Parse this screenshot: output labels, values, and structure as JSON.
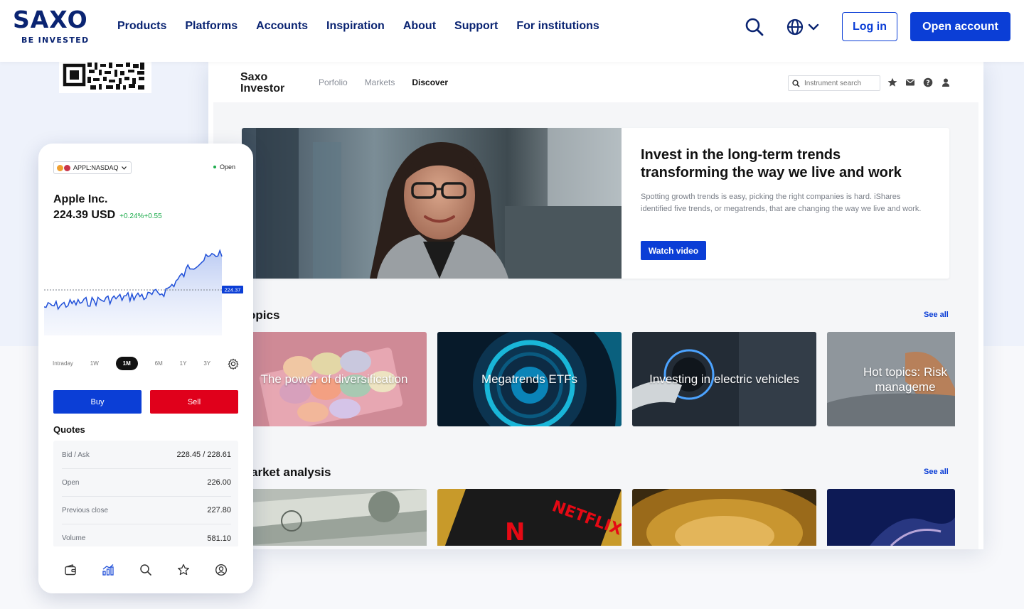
{
  "brand": {
    "name": "SAXO",
    "tagline": "BE INVESTED",
    "accent": "#0b3ed6",
    "navy": "#0a2472"
  },
  "nav": {
    "links": [
      "Products",
      "Platforms",
      "Accounts",
      "Inspiration",
      "About",
      "Support",
      "For institutions"
    ],
    "login_label": "Log in",
    "open_account_label": "Open account"
  },
  "desktop": {
    "app_title": "Saxo Investor",
    "tabs": [
      "Porfolio",
      "Markets",
      "Discover"
    ],
    "active_tab": "Discover",
    "search_placeholder": "Instrument search",
    "hero": {
      "title": "Invest in the long-term trends transforming the way we live and work",
      "body": "Spotting growth trends is easy, picking the right companies is hard. iShares identified five trends, or megatrends, that are changing the way we live and work.",
      "button": "Watch video"
    },
    "topics": {
      "title": "opics",
      "see_all": "See all",
      "tiles": [
        "The power of diversification",
        "Megatrends ETFs",
        "Investing in electric vehicles",
        "Hot topics: Risk manageme"
      ]
    },
    "market_analysis": {
      "title": "arket analysis",
      "see_all": "See all"
    }
  },
  "phone": {
    "ticker": "APPL:NASDAQ",
    "market_status": "Open",
    "company": "Apple Inc.",
    "price": "224.39 USD",
    "change_pct": "+0.24%",
    "change_abs": "+0.55",
    "chart_last_label": "224.37",
    "periods": [
      "Intraday",
      "1W",
      "1M",
      "6M",
      "1Y",
      "3Y"
    ],
    "active_period": "1M",
    "buy_label": "Buy",
    "sell_label": "Sell",
    "quotes_title": "Quotes",
    "quotes": [
      {
        "label": "Bid / Ask",
        "value": "228.45 / 228.61"
      },
      {
        "label": "Open",
        "value": "226.00"
      },
      {
        "label": "Previous close",
        "value": "227.80"
      },
      {
        "label": "Volume",
        "value": "581.10"
      }
    ],
    "bottom_nav_icons": [
      "wallet-icon",
      "chart-bars-icon",
      "search-icon",
      "star-icon",
      "profile-icon"
    ]
  }
}
